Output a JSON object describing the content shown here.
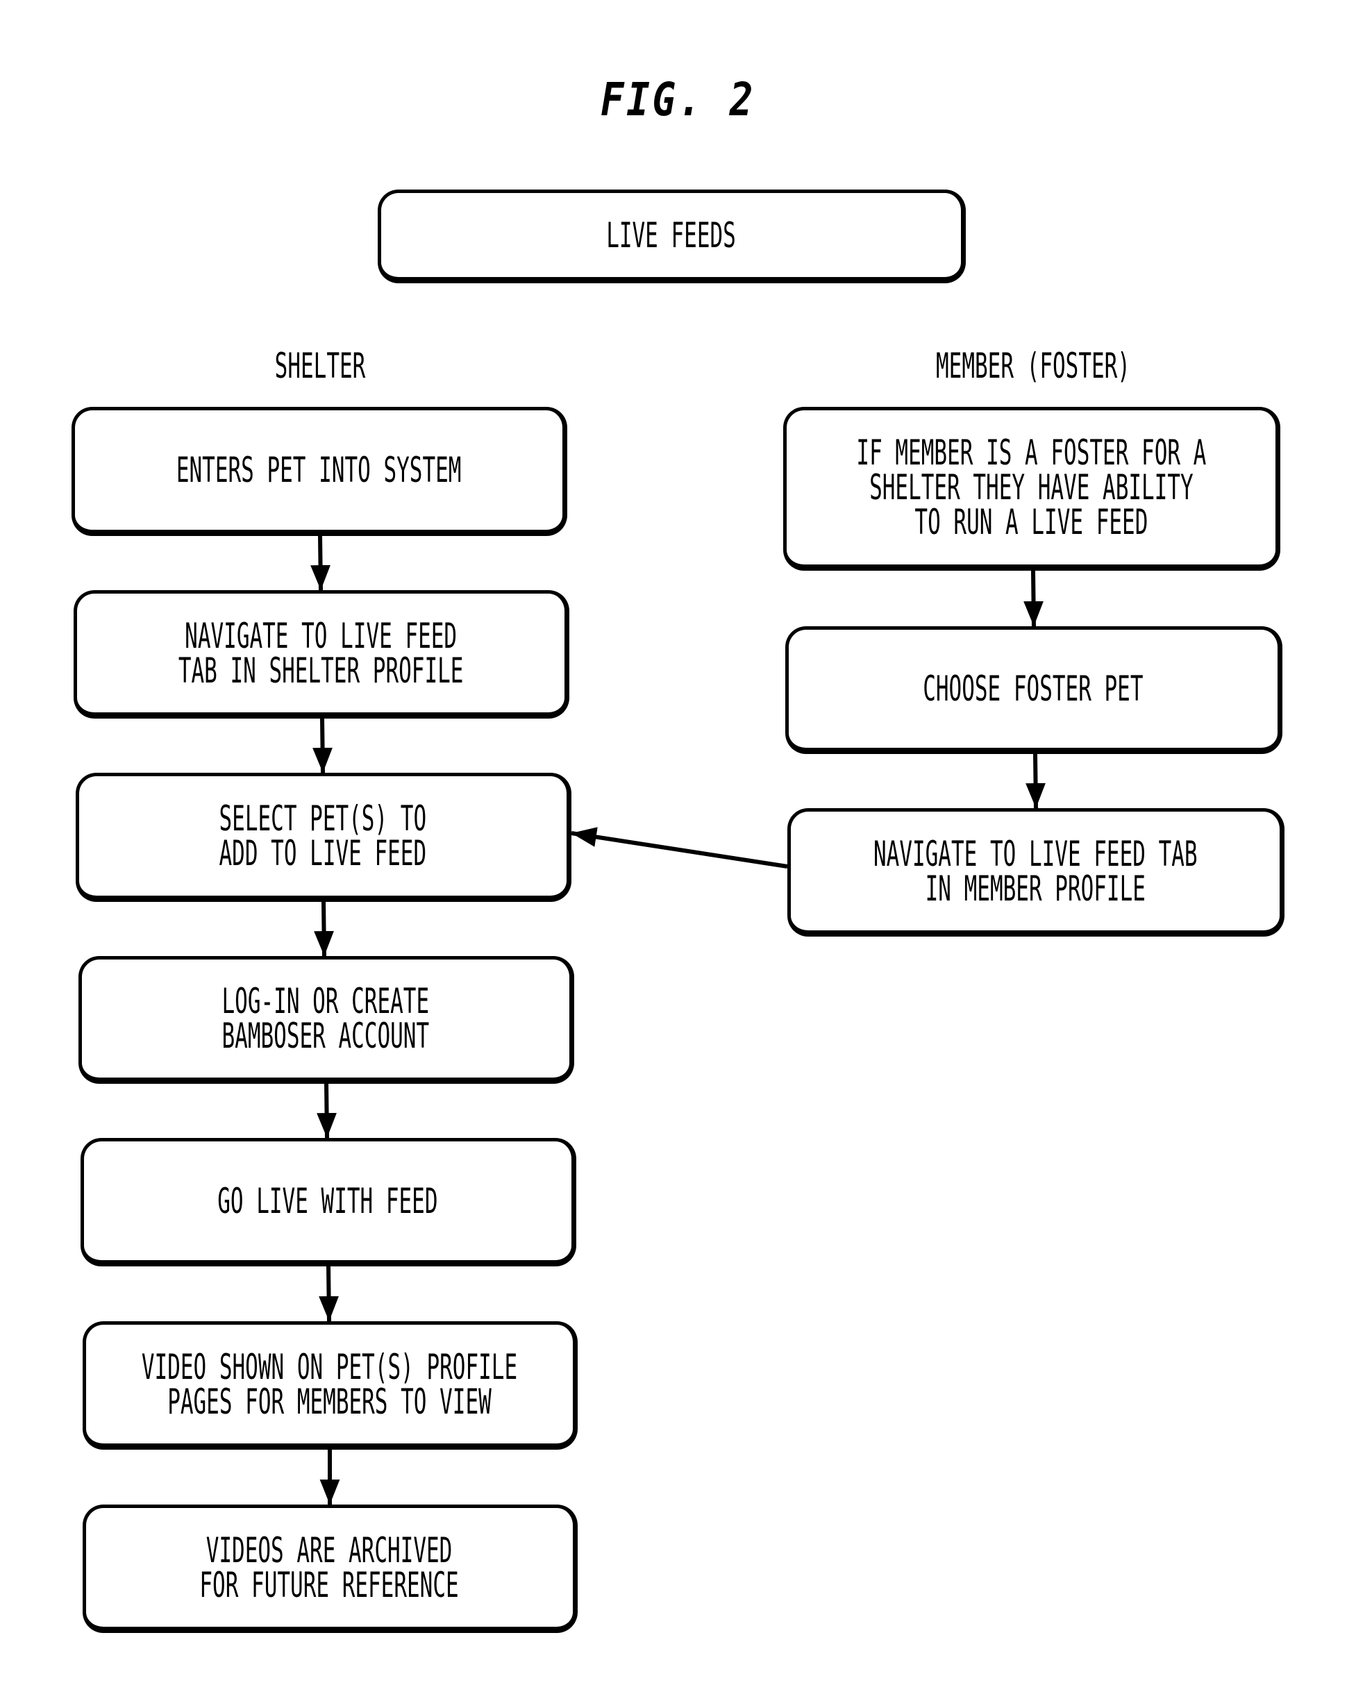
{
  "figure_label": "FIG. 2",
  "root": {
    "label": "LIVE FEEDS"
  },
  "columns": {
    "shelter": {
      "header": "SHELTER",
      "steps": [
        "ENTERS PET INTO SYSTEM",
        "NAVIGATE TO LIVE FEED\nTAB IN SHELTER PROFILE",
        "SELECT PET(S) TO\nADD TO LIVE FEED",
        "LOG-IN OR CREATE\nBAMBOSER ACCOUNT",
        "GO LIVE WITH FEED",
        "VIDEO SHOWN ON PET(S) PROFILE\nPAGES FOR MEMBERS TO VIEW",
        "VIDEOS ARE ARCHIVED\nFOR FUTURE REFERENCE"
      ]
    },
    "member": {
      "header": "MEMBER (FOSTER)",
      "steps": [
        "IF MEMBER IS A FOSTER FOR A\nSHELTER THEY HAVE ABILITY\nTO RUN A LIVE FEED",
        "CHOOSE FOSTER PET",
        "NAVIGATE TO LIVE FEED TAB\nIN MEMBER PROFILE"
      ]
    }
  },
  "connections": [
    {
      "from": "shelter-step-1",
      "to": "shelter-step-2"
    },
    {
      "from": "shelter-step-2",
      "to": "shelter-step-3"
    },
    {
      "from": "shelter-step-3",
      "to": "shelter-step-4"
    },
    {
      "from": "shelter-step-4",
      "to": "shelter-step-5"
    },
    {
      "from": "shelter-step-5",
      "to": "shelter-step-6"
    },
    {
      "from": "shelter-step-6",
      "to": "shelter-step-7"
    },
    {
      "from": "member-step-1",
      "to": "member-step-2"
    },
    {
      "from": "member-step-2",
      "to": "member-step-3"
    },
    {
      "from": "member-step-3",
      "to": "shelter-step-3"
    }
  ]
}
